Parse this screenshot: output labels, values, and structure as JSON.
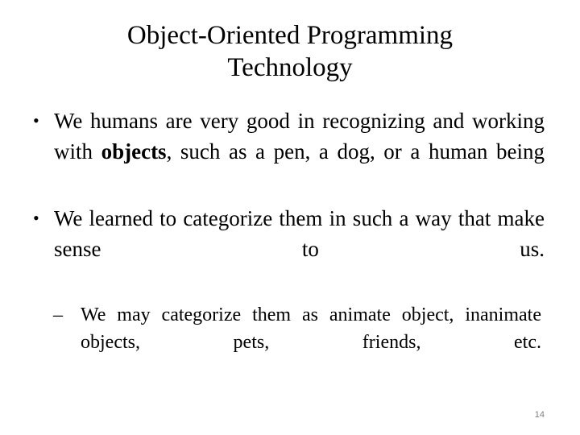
{
  "slide": {
    "title": "Object-Oriented Programming\nTechnology",
    "page_number": "14",
    "text_color": "#000000",
    "background_color": "#ffffff",
    "page_number_color": "#808080",
    "bullets": [
      {
        "level": 1,
        "marker": "•",
        "text_before_bold": "We humans are very good in recognizing and working with ",
        "bold_text": "objects",
        "text_after_bold": ", such as a pen, a dog, or a human being"
      },
      {
        "level": 1,
        "marker": "•",
        "text": "We learned to categorize them in such a way that make sense to us."
      },
      {
        "level": 2,
        "marker": "–",
        "text": "We may categorize them as animate object, inanimate objects, pets, friends, etc."
      }
    ]
  }
}
